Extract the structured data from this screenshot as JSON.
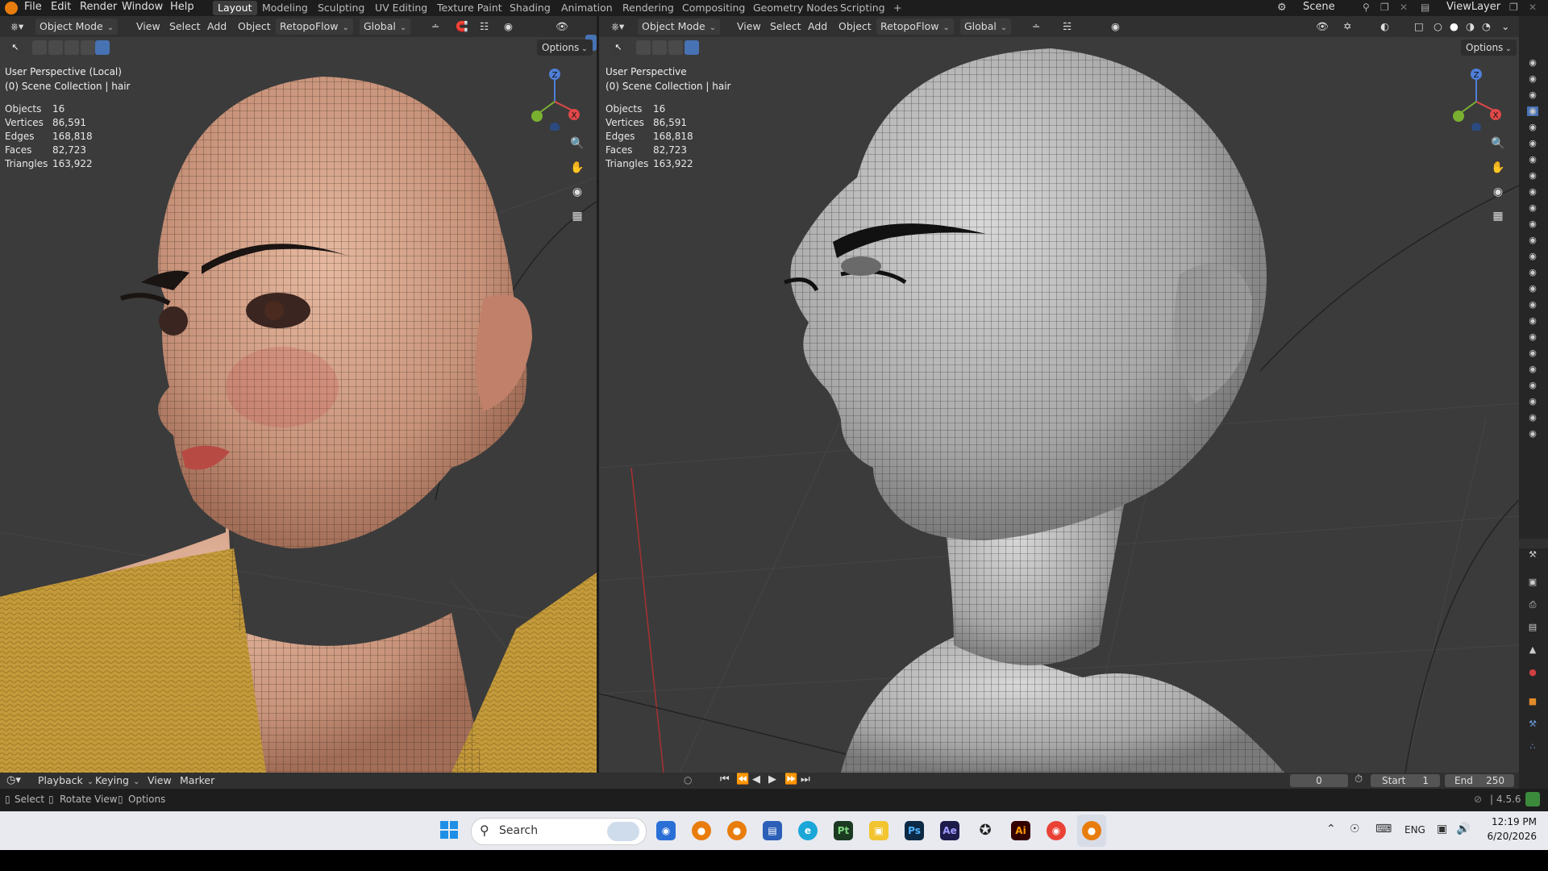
{
  "menu": {
    "items": [
      "File",
      "Edit",
      "Render",
      "Window",
      "Help"
    ]
  },
  "workspaces": [
    "Layout",
    "Modeling",
    "Sculpting",
    "UV Editing",
    "Texture Paint",
    "Shading",
    "Animation",
    "Rendering",
    "Compositing",
    "Geometry Nodes",
    "Scripting"
  ],
  "workspace_add": "+",
  "scene": {
    "label": "Scene",
    "view_layer": "ViewLayer"
  },
  "left_view": {
    "mode": "Object Mode",
    "menus": [
      "View",
      "Select",
      "Add",
      "Object"
    ],
    "addon": "RetopoFlow",
    "orientation": "Global",
    "options": "Options",
    "title": "User Perspective (Local)",
    "collection": "(0) Scene Collection | hair",
    "stats": [
      {
        "k": "Objects",
        "v": "16"
      },
      {
        "k": "Vertices",
        "v": "86,591"
      },
      {
        "k": "Edges",
        "v": "168,818"
      },
      {
        "k": "Faces",
        "v": "82,723"
      },
      {
        "k": "Triangles",
        "v": "163,922"
      }
    ],
    "gizmo": {
      "z": "Z",
      "x": "X"
    }
  },
  "right_view": {
    "mode": "Object Mode",
    "menus": [
      "View",
      "Select",
      "Add",
      "Object"
    ],
    "addon": "RetopoFlow",
    "orientation": "Global",
    "options": "Options",
    "title": "User Perspective",
    "collection": "(0) Scene Collection | hair",
    "stats": [
      {
        "k": "Objects",
        "v": "16"
      },
      {
        "k": "Vertices",
        "v": "86,591"
      },
      {
        "k": "Edges",
        "v": "168,818"
      },
      {
        "k": "Faces",
        "v": "82,723"
      },
      {
        "k": "Triangles",
        "v": "163,922"
      }
    ],
    "gizmo": {
      "z": "Z",
      "x": "X"
    }
  },
  "timeline": {
    "menus": [
      "Playback",
      "Keying",
      "View",
      "Marker"
    ],
    "current_frame": "0",
    "start_label": "Start",
    "start": "1",
    "end_label": "End",
    "end": "250"
  },
  "statusbar": {
    "select": "Select",
    "rotate": "Rotate View",
    "options": "Options",
    "version": "4.5.6"
  },
  "taskbar": {
    "search_placeholder": "Search",
    "time": "12:19 PM",
    "date": "6/20/2026",
    "lang": "ENG",
    "apps": [
      "Pt",
      "Ps",
      "Ae",
      "Ai"
    ]
  },
  "colors": {
    "accent": "#4772b3",
    "active_tab": "#3d3d3d",
    "viewport": "#3b3b3b"
  }
}
